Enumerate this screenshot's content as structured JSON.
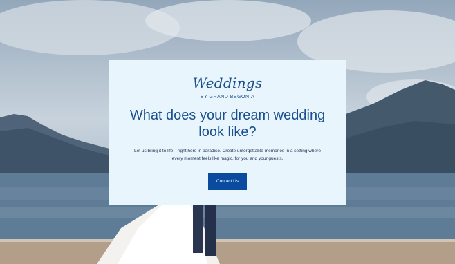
{
  "brand": {
    "script_name": "Weddings",
    "subtitle": "BY GRAND BEGONIA"
  },
  "hero": {
    "headline_line1": "What does your dream wedding",
    "headline_line2": "look like?",
    "body_line1": "Let us bring it to life—right here in paradise. Create unforgettable memories in a setting where",
    "body_line2": "every moment feels like magic, for you and your guests.",
    "cta_label": "Contact Us"
  },
  "colors": {
    "card_background": "#e8f5fd",
    "headline": "#1b4f8e",
    "cta_background": "#0a4ba0",
    "cta_text": "#ffffff"
  }
}
